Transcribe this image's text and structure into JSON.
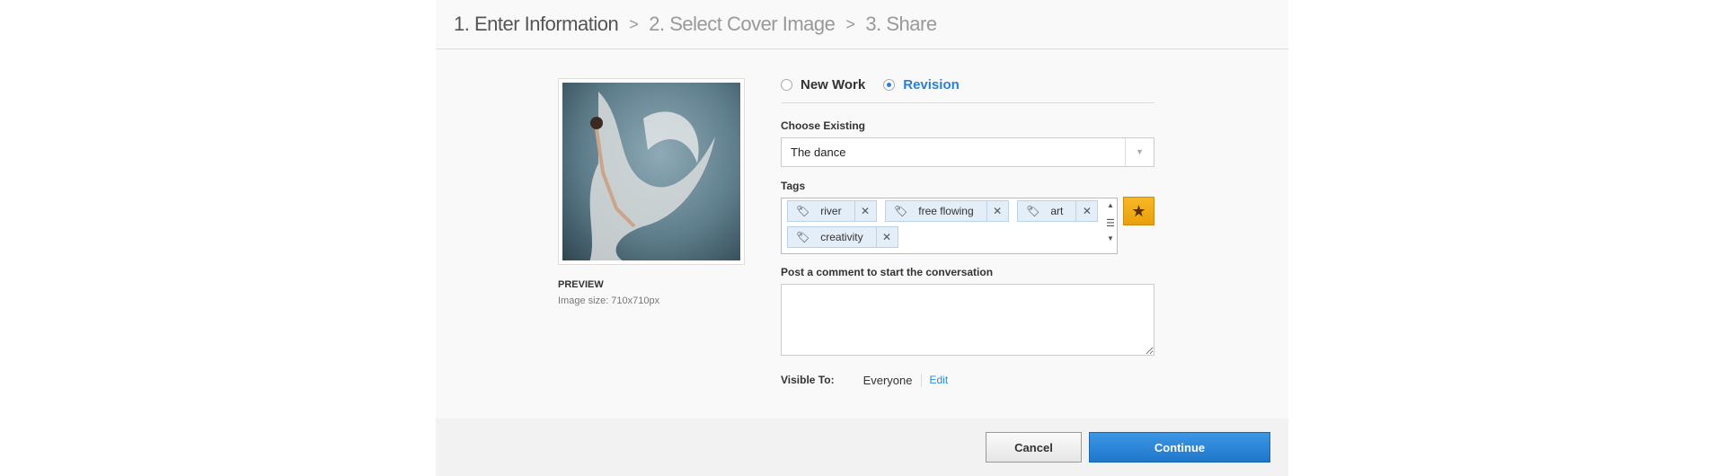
{
  "steps": [
    {
      "label": "1. Enter Information"
    },
    {
      "label": "2. Select Cover Image"
    },
    {
      "label": "3. Share"
    }
  ],
  "step_separator": ">",
  "preview": {
    "label": "PREVIEW",
    "size": "Image size: 710x710px"
  },
  "work_type": {
    "options": [
      {
        "label": "New Work",
        "selected": false
      },
      {
        "label": "Revision",
        "selected": true
      }
    ]
  },
  "choose_existing": {
    "label": "Choose Existing",
    "value": "The dance"
  },
  "tags": {
    "label": "Tags",
    "items": [
      "river",
      "free flowing",
      "art",
      "creativity"
    ]
  },
  "comment": {
    "label": "Post a comment to start the conversation",
    "value": ""
  },
  "visibility": {
    "label": "Visible To:",
    "value": "Everyone",
    "edit": "Edit"
  },
  "buttons": {
    "cancel": "Cancel",
    "continue": "Continue"
  },
  "colors": {
    "accent": "#2a7fd2",
    "star": "#f2ac1a"
  }
}
